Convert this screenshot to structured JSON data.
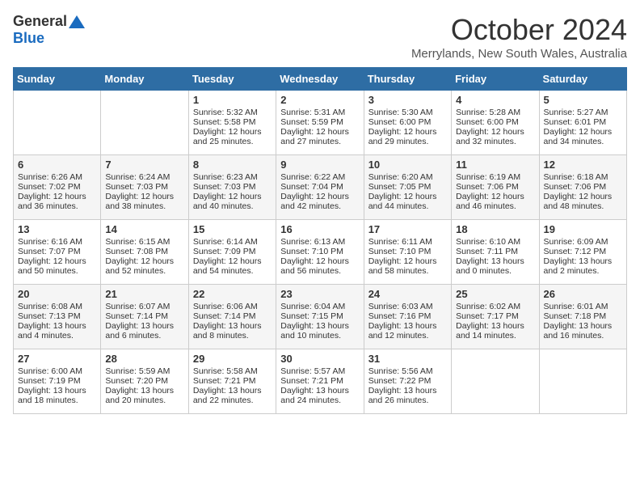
{
  "header": {
    "logo_general": "General",
    "logo_blue": "Blue",
    "month_title": "October 2024",
    "location": "Merrylands, New South Wales, Australia"
  },
  "days_of_week": [
    "Sunday",
    "Monday",
    "Tuesday",
    "Wednesday",
    "Thursday",
    "Friday",
    "Saturday"
  ],
  "weeks": [
    [
      {
        "day": "",
        "info": ""
      },
      {
        "day": "",
        "info": ""
      },
      {
        "day": "1",
        "info": "Sunrise: 5:32 AM\nSunset: 5:58 PM\nDaylight: 12 hours\nand 25 minutes."
      },
      {
        "day": "2",
        "info": "Sunrise: 5:31 AM\nSunset: 5:59 PM\nDaylight: 12 hours\nand 27 minutes."
      },
      {
        "day": "3",
        "info": "Sunrise: 5:30 AM\nSunset: 6:00 PM\nDaylight: 12 hours\nand 29 minutes."
      },
      {
        "day": "4",
        "info": "Sunrise: 5:28 AM\nSunset: 6:00 PM\nDaylight: 12 hours\nand 32 minutes."
      },
      {
        "day": "5",
        "info": "Sunrise: 5:27 AM\nSunset: 6:01 PM\nDaylight: 12 hours\nand 34 minutes."
      }
    ],
    [
      {
        "day": "6",
        "info": "Sunrise: 6:26 AM\nSunset: 7:02 PM\nDaylight: 12 hours\nand 36 minutes."
      },
      {
        "day": "7",
        "info": "Sunrise: 6:24 AM\nSunset: 7:03 PM\nDaylight: 12 hours\nand 38 minutes."
      },
      {
        "day": "8",
        "info": "Sunrise: 6:23 AM\nSunset: 7:03 PM\nDaylight: 12 hours\nand 40 minutes."
      },
      {
        "day": "9",
        "info": "Sunrise: 6:22 AM\nSunset: 7:04 PM\nDaylight: 12 hours\nand 42 minutes."
      },
      {
        "day": "10",
        "info": "Sunrise: 6:20 AM\nSunset: 7:05 PM\nDaylight: 12 hours\nand 44 minutes."
      },
      {
        "day": "11",
        "info": "Sunrise: 6:19 AM\nSunset: 7:06 PM\nDaylight: 12 hours\nand 46 minutes."
      },
      {
        "day": "12",
        "info": "Sunrise: 6:18 AM\nSunset: 7:06 PM\nDaylight: 12 hours\nand 48 minutes."
      }
    ],
    [
      {
        "day": "13",
        "info": "Sunrise: 6:16 AM\nSunset: 7:07 PM\nDaylight: 12 hours\nand 50 minutes."
      },
      {
        "day": "14",
        "info": "Sunrise: 6:15 AM\nSunset: 7:08 PM\nDaylight: 12 hours\nand 52 minutes."
      },
      {
        "day": "15",
        "info": "Sunrise: 6:14 AM\nSunset: 7:09 PM\nDaylight: 12 hours\nand 54 minutes."
      },
      {
        "day": "16",
        "info": "Sunrise: 6:13 AM\nSunset: 7:10 PM\nDaylight: 12 hours\nand 56 minutes."
      },
      {
        "day": "17",
        "info": "Sunrise: 6:11 AM\nSunset: 7:10 PM\nDaylight: 12 hours\nand 58 minutes."
      },
      {
        "day": "18",
        "info": "Sunrise: 6:10 AM\nSunset: 7:11 PM\nDaylight: 13 hours\nand 0 minutes."
      },
      {
        "day": "19",
        "info": "Sunrise: 6:09 AM\nSunset: 7:12 PM\nDaylight: 13 hours\nand 2 minutes."
      }
    ],
    [
      {
        "day": "20",
        "info": "Sunrise: 6:08 AM\nSunset: 7:13 PM\nDaylight: 13 hours\nand 4 minutes."
      },
      {
        "day": "21",
        "info": "Sunrise: 6:07 AM\nSunset: 7:14 PM\nDaylight: 13 hours\nand 6 minutes."
      },
      {
        "day": "22",
        "info": "Sunrise: 6:06 AM\nSunset: 7:14 PM\nDaylight: 13 hours\nand 8 minutes."
      },
      {
        "day": "23",
        "info": "Sunrise: 6:04 AM\nSunset: 7:15 PM\nDaylight: 13 hours\nand 10 minutes."
      },
      {
        "day": "24",
        "info": "Sunrise: 6:03 AM\nSunset: 7:16 PM\nDaylight: 13 hours\nand 12 minutes."
      },
      {
        "day": "25",
        "info": "Sunrise: 6:02 AM\nSunset: 7:17 PM\nDaylight: 13 hours\nand 14 minutes."
      },
      {
        "day": "26",
        "info": "Sunrise: 6:01 AM\nSunset: 7:18 PM\nDaylight: 13 hours\nand 16 minutes."
      }
    ],
    [
      {
        "day": "27",
        "info": "Sunrise: 6:00 AM\nSunset: 7:19 PM\nDaylight: 13 hours\nand 18 minutes."
      },
      {
        "day": "28",
        "info": "Sunrise: 5:59 AM\nSunset: 7:20 PM\nDaylight: 13 hours\nand 20 minutes."
      },
      {
        "day": "29",
        "info": "Sunrise: 5:58 AM\nSunset: 7:21 PM\nDaylight: 13 hours\nand 22 minutes."
      },
      {
        "day": "30",
        "info": "Sunrise: 5:57 AM\nSunset: 7:21 PM\nDaylight: 13 hours\nand 24 minutes."
      },
      {
        "day": "31",
        "info": "Sunrise: 5:56 AM\nSunset: 7:22 PM\nDaylight: 13 hours\nand 26 minutes."
      },
      {
        "day": "",
        "info": ""
      },
      {
        "day": "",
        "info": ""
      }
    ]
  ]
}
